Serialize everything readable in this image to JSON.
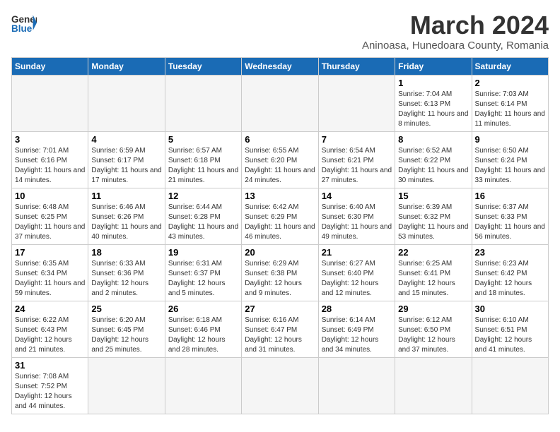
{
  "header": {
    "logo_general": "General",
    "logo_blue": "Blue",
    "title": "March 2024",
    "subtitle": "Aninoasa, Hunedoara County, Romania"
  },
  "weekdays": [
    "Sunday",
    "Monday",
    "Tuesday",
    "Wednesday",
    "Thursday",
    "Friday",
    "Saturday"
  ],
  "weeks": [
    [
      {
        "day": "",
        "info": ""
      },
      {
        "day": "",
        "info": ""
      },
      {
        "day": "",
        "info": ""
      },
      {
        "day": "",
        "info": ""
      },
      {
        "day": "",
        "info": ""
      },
      {
        "day": "1",
        "info": "Sunrise: 7:04 AM\nSunset: 6:13 PM\nDaylight: 11 hours and 8 minutes."
      },
      {
        "day": "2",
        "info": "Sunrise: 7:03 AM\nSunset: 6:14 PM\nDaylight: 11 hours and 11 minutes."
      }
    ],
    [
      {
        "day": "3",
        "info": "Sunrise: 7:01 AM\nSunset: 6:16 PM\nDaylight: 11 hours and 14 minutes."
      },
      {
        "day": "4",
        "info": "Sunrise: 6:59 AM\nSunset: 6:17 PM\nDaylight: 11 hours and 17 minutes."
      },
      {
        "day": "5",
        "info": "Sunrise: 6:57 AM\nSunset: 6:18 PM\nDaylight: 11 hours and 21 minutes."
      },
      {
        "day": "6",
        "info": "Sunrise: 6:55 AM\nSunset: 6:20 PM\nDaylight: 11 hours and 24 minutes."
      },
      {
        "day": "7",
        "info": "Sunrise: 6:54 AM\nSunset: 6:21 PM\nDaylight: 11 hours and 27 minutes."
      },
      {
        "day": "8",
        "info": "Sunrise: 6:52 AM\nSunset: 6:22 PM\nDaylight: 11 hours and 30 minutes."
      },
      {
        "day": "9",
        "info": "Sunrise: 6:50 AM\nSunset: 6:24 PM\nDaylight: 11 hours and 33 minutes."
      }
    ],
    [
      {
        "day": "10",
        "info": "Sunrise: 6:48 AM\nSunset: 6:25 PM\nDaylight: 11 hours and 37 minutes."
      },
      {
        "day": "11",
        "info": "Sunrise: 6:46 AM\nSunset: 6:26 PM\nDaylight: 11 hours and 40 minutes."
      },
      {
        "day": "12",
        "info": "Sunrise: 6:44 AM\nSunset: 6:28 PM\nDaylight: 11 hours and 43 minutes."
      },
      {
        "day": "13",
        "info": "Sunrise: 6:42 AM\nSunset: 6:29 PM\nDaylight: 11 hours and 46 minutes."
      },
      {
        "day": "14",
        "info": "Sunrise: 6:40 AM\nSunset: 6:30 PM\nDaylight: 11 hours and 49 minutes."
      },
      {
        "day": "15",
        "info": "Sunrise: 6:39 AM\nSunset: 6:32 PM\nDaylight: 11 hours and 53 minutes."
      },
      {
        "day": "16",
        "info": "Sunrise: 6:37 AM\nSunset: 6:33 PM\nDaylight: 11 hours and 56 minutes."
      }
    ],
    [
      {
        "day": "17",
        "info": "Sunrise: 6:35 AM\nSunset: 6:34 PM\nDaylight: 11 hours and 59 minutes."
      },
      {
        "day": "18",
        "info": "Sunrise: 6:33 AM\nSunset: 6:36 PM\nDaylight: 12 hours and 2 minutes."
      },
      {
        "day": "19",
        "info": "Sunrise: 6:31 AM\nSunset: 6:37 PM\nDaylight: 12 hours and 5 minutes."
      },
      {
        "day": "20",
        "info": "Sunrise: 6:29 AM\nSunset: 6:38 PM\nDaylight: 12 hours and 9 minutes."
      },
      {
        "day": "21",
        "info": "Sunrise: 6:27 AM\nSunset: 6:40 PM\nDaylight: 12 hours and 12 minutes."
      },
      {
        "day": "22",
        "info": "Sunrise: 6:25 AM\nSunset: 6:41 PM\nDaylight: 12 hours and 15 minutes."
      },
      {
        "day": "23",
        "info": "Sunrise: 6:23 AM\nSunset: 6:42 PM\nDaylight: 12 hours and 18 minutes."
      }
    ],
    [
      {
        "day": "24",
        "info": "Sunrise: 6:22 AM\nSunset: 6:43 PM\nDaylight: 12 hours and 21 minutes."
      },
      {
        "day": "25",
        "info": "Sunrise: 6:20 AM\nSunset: 6:45 PM\nDaylight: 12 hours and 25 minutes."
      },
      {
        "day": "26",
        "info": "Sunrise: 6:18 AM\nSunset: 6:46 PM\nDaylight: 12 hours and 28 minutes."
      },
      {
        "day": "27",
        "info": "Sunrise: 6:16 AM\nSunset: 6:47 PM\nDaylight: 12 hours and 31 minutes."
      },
      {
        "day": "28",
        "info": "Sunrise: 6:14 AM\nSunset: 6:49 PM\nDaylight: 12 hours and 34 minutes."
      },
      {
        "day": "29",
        "info": "Sunrise: 6:12 AM\nSunset: 6:50 PM\nDaylight: 12 hours and 37 minutes."
      },
      {
        "day": "30",
        "info": "Sunrise: 6:10 AM\nSunset: 6:51 PM\nDaylight: 12 hours and 41 minutes."
      }
    ],
    [
      {
        "day": "31",
        "info": "Sunrise: 7:08 AM\nSunset: 7:52 PM\nDaylight: 12 hours and 44 minutes."
      },
      {
        "day": "",
        "info": ""
      },
      {
        "day": "",
        "info": ""
      },
      {
        "day": "",
        "info": ""
      },
      {
        "day": "",
        "info": ""
      },
      {
        "day": "",
        "info": ""
      },
      {
        "day": "",
        "info": ""
      }
    ]
  ]
}
